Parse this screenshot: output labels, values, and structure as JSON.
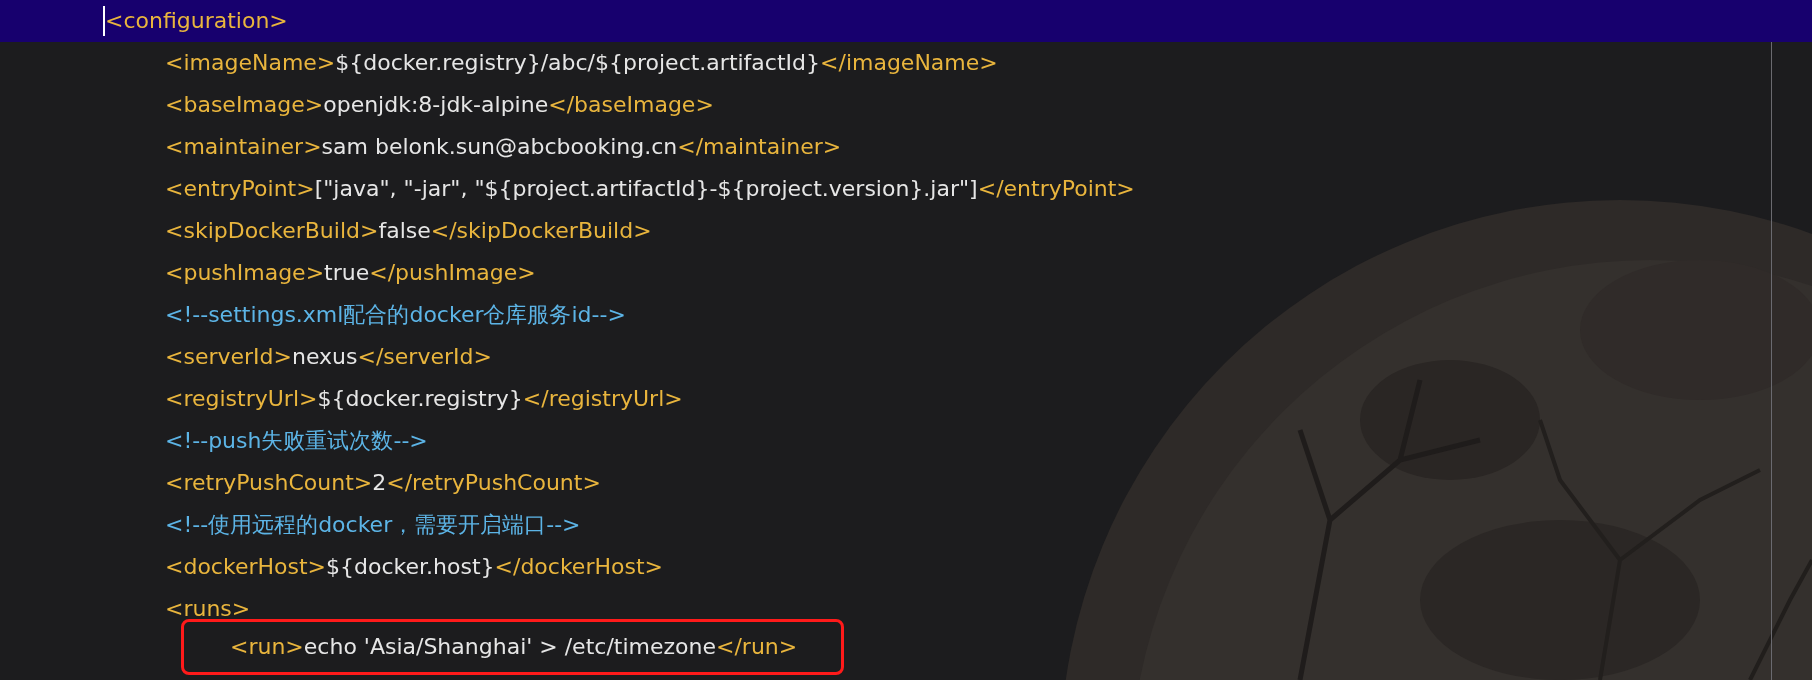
{
  "editor": {
    "lines": [
      {
        "kind": "element",
        "open_tag": "<configuration>",
        "current": true,
        "cursor": true,
        "children": [
          {
            "kind": "element",
            "open_tag": "<imageName>",
            "value": "${docker.registry}/abc/${project.artifactId}",
            "close_tag": "</imageName>"
          },
          {
            "kind": "element",
            "open_tag": "<baseImage>",
            "value": "openjdk:8-jdk-alpine",
            "close_tag": "</baseImage>"
          },
          {
            "kind": "element",
            "open_tag": "<maintainer>",
            "value": "sam belonk.sun@abcbooking.cn",
            "close_tag": "</maintainer>"
          },
          {
            "kind": "element",
            "open_tag": "<entryPoint>",
            "value": "[\"java\", \"-jar\", \"${project.artifactId}-${project.version}.jar\"]",
            "close_tag": "</entryPoint>"
          },
          {
            "kind": "element",
            "open_tag": "<skipDockerBuild>",
            "value": "false",
            "close_tag": "</skipDockerBuild>"
          },
          {
            "kind": "element",
            "open_tag": "<pushImage>",
            "value": "true",
            "close_tag": "</pushImage>"
          },
          {
            "kind": "comment",
            "text": "<!--settings.xml配合的docker仓库服务id-->"
          },
          {
            "kind": "element",
            "open_tag": "<serverId>",
            "value": "nexus",
            "close_tag": "</serverId>"
          },
          {
            "kind": "element",
            "open_tag": "<registryUrl>",
            "value": "${docker.registry}",
            "close_tag": "</registryUrl>"
          },
          {
            "kind": "comment",
            "text": "<!--push失败重试次数-->"
          },
          {
            "kind": "element",
            "open_tag": "<retryPushCount>",
            "value": "2",
            "close_tag": "</retryPushCount>"
          },
          {
            "kind": "comment",
            "text": "<!--使用远程的docker，需要开启端口-->"
          },
          {
            "kind": "element",
            "open_tag": "<dockerHost>",
            "value": "${docker.host}",
            "close_tag": "</dockerHost>"
          },
          {
            "kind": "element",
            "open_tag": "<runs>",
            "children": [
              {
                "kind": "element",
                "open_tag": "<run>",
                "value": "echo 'Asia/Shanghai' > /etc/timezone",
                "close_tag": "</run>",
                "outlined": true
              }
            ]
          }
        ]
      }
    ]
  }
}
